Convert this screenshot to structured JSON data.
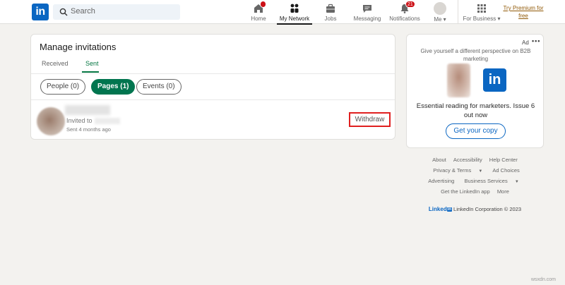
{
  "header": {
    "logo_text": "in",
    "search_placeholder": "Search",
    "nav": [
      {
        "label": "Home",
        "icon": "home-icon",
        "badge": "dot"
      },
      {
        "label": "My Network",
        "icon": "my-network-icon",
        "active": true
      },
      {
        "label": "Jobs",
        "icon": "briefcase-icon"
      },
      {
        "label": "Messaging",
        "icon": "messaging-icon"
      },
      {
        "label": "Notifications",
        "icon": "bell-icon",
        "badge": "21"
      },
      {
        "label": "Me",
        "icon": "avatar"
      },
      {
        "label": "For Business",
        "icon": "grid-icon"
      }
    ],
    "premium_link": "Try Premium for free"
  },
  "main": {
    "title": "Manage invitations",
    "tabs": [
      {
        "label": "Received",
        "active": false
      },
      {
        "label": "Sent",
        "active": true
      }
    ],
    "filters": [
      {
        "label": "People (0)",
        "active": false
      },
      {
        "label": "Pages (1)",
        "active": true
      },
      {
        "label": "Events (0)",
        "active": false
      }
    ],
    "invitations": [
      {
        "invited_prefix": "Invited to",
        "sent_time": "Sent 4 months ago",
        "action_label": "Withdraw"
      }
    ]
  },
  "ad": {
    "label": "Ad",
    "more": "•••",
    "tagline": "Give yourself a different perspective on B2B marketing",
    "logo_text": "in",
    "copy": "Essential reading for marketers. Issue 6 out now",
    "cta_label": "Get your copy"
  },
  "footer": {
    "links_row1": [
      "About",
      "Accessibility",
      "Help Center"
    ],
    "links_row2": [
      "Privacy & Terms",
      "Ad Choices"
    ],
    "links_row3": [
      "Advertising",
      "Business Services"
    ],
    "links_row4": [
      "Get the LinkedIn app",
      "More"
    ],
    "brand_word": "Linked",
    "brand_box": "in",
    "copyright": "LinkedIn Corporation © 2023"
  },
  "watermark": "wsxdn.com",
  "colors": {
    "brand_blue": "#0a66c2",
    "active_green": "#01754f",
    "highlight_red": "#e02020",
    "badge_red": "#cc1016",
    "page_bg": "#f3f2ef"
  }
}
